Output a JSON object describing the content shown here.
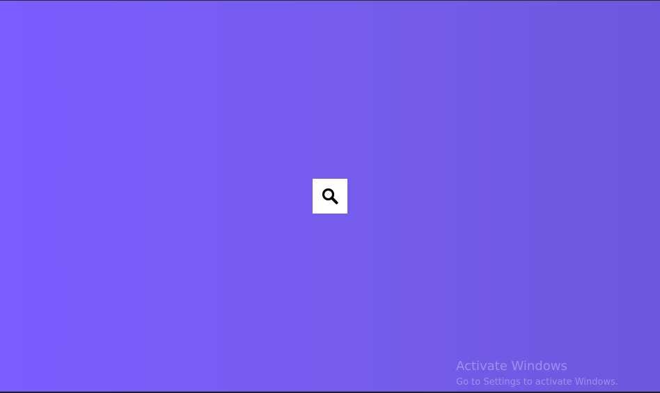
{
  "page": {
    "background_colors": [
      "#7b5cff",
      "#755ceb",
      "#6d58dd"
    ]
  },
  "search_button": {
    "icon": "search-icon",
    "background": "#ffffff",
    "icon_color": "#000000"
  },
  "watermark": {
    "title": "Activate Windows",
    "subtitle": "Go to Settings to activate Windows."
  }
}
